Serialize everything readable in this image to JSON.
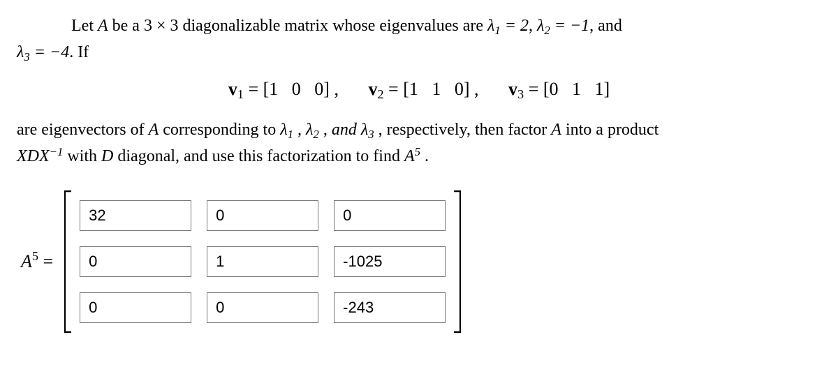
{
  "problem": {
    "text_part1": "Let ",
    "matrix_name": "A",
    "text_part2": " be a 3 × 3 diagonalizable matrix whose eigenvalues are ",
    "lambda1": "λ₁ = 2",
    "lambda2": "λ₂ = −1",
    "text_and": ", and",
    "lambda3": "λ₃ = −4",
    "text_if": ". If",
    "v1_label": "v₁",
    "v1": "[1  0  0]",
    "v2_label": "v₂",
    "v2": "[1  1  0]",
    "v3_label": "v₃",
    "v3": "[0  1  1]",
    "eq_sep": ",",
    "text_part3a": "are eigenvectors of ",
    "text_part3b": " corresponding to ",
    "ev_list": "λ₁ , λ₂ , and λ₃",
    "text_part3c": ", respectively, then factor ",
    "text_part3d": " into a product",
    "factorization": "XDX⁻¹",
    "text_part4a": " with ",
    "D_name": "D",
    "text_part4b": " diagonal, and use this factorization to find ",
    "target": "A⁵",
    "period": "."
  },
  "answer": {
    "lhs": "A⁵ =",
    "matrix": [
      [
        "32",
        "0",
        "0"
      ],
      [
        "0",
        "1",
        "-1025"
      ],
      [
        "0",
        "0",
        "-243"
      ]
    ]
  }
}
